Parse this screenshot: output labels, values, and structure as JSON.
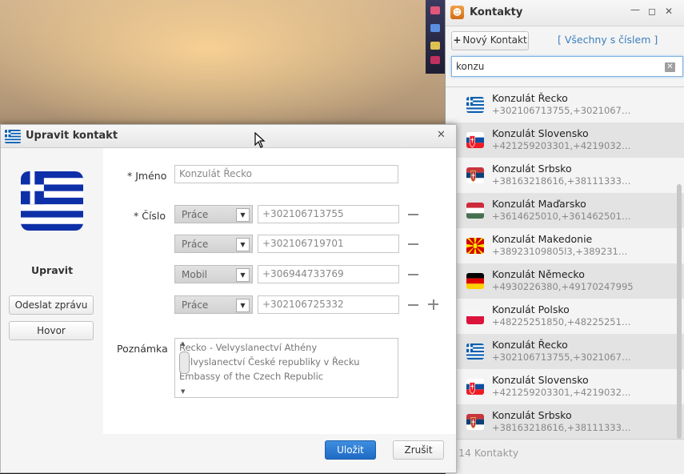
{
  "contacts_window": {
    "title": "Kontakty",
    "app_icon": "contacts-book-icon",
    "toolbar": {
      "new_contact_label": "Nový Kontakt",
      "filter_label": "[ Všechny s číslem ]"
    },
    "search": {
      "value": "konzu",
      "placeholder": ""
    },
    "items": [
      {
        "name": "Konzulát Řecko",
        "numbers": "+302106713755,+3021067…",
        "flag": "greece"
      },
      {
        "name": "Konzulát Slovensko",
        "numbers": "+421259203301,+4219032…",
        "flag": "slovakia"
      },
      {
        "name": "Konzulát Srbsko",
        "numbers": "+38163218616,+38111333…",
        "flag": "serbia"
      },
      {
        "name": "Konzulát Maďarsko",
        "numbers": "+3614625010,+361462501…",
        "flag": "hungary"
      },
      {
        "name": "Konzulát Makedonie",
        "numbers": "+38923109805l3,+389231…",
        "flag": "macedonia"
      },
      {
        "name": "Konzulát Německo",
        "numbers": "+4930226380,+49170247995",
        "flag": "germany"
      },
      {
        "name": "Konzulát Polsko",
        "numbers": "+48225251850,+48225251…",
        "flag": "poland"
      },
      {
        "name": "Konzulát Řecko",
        "numbers": "+302106713755,+3021067…",
        "flag": "greece"
      },
      {
        "name": "Konzulát Slovensko",
        "numbers": "+421259203301,+4219032…",
        "flag": "slovakia"
      },
      {
        "name": "Konzulát Srbsko",
        "numbers": "+38163218616,+38111333…",
        "flag": "serbia"
      }
    ],
    "footer": "14 Kontakty"
  },
  "edit_dialog": {
    "title": "Upravit kontakt",
    "avatar_caption": "Upravit",
    "send_message_label": "Odeslat zprávu",
    "call_label": "Hovor",
    "name_label": "* Jméno",
    "name_value": "Konzulát Řecko",
    "number_label": "* Číslo",
    "phones": [
      {
        "type": "Práce",
        "number": "+302106713755"
      },
      {
        "type": "Práce",
        "number": "+302106719701"
      },
      {
        "type": "Mobil",
        "number": "+306944733769"
      },
      {
        "type": "Práce",
        "number": "+302106725332"
      }
    ],
    "note_label": "Poznámka",
    "note_lines": [
      "Řecko - Velvyslanectví Athény",
      "Velvyslanectví České republiky v Řecku",
      "Embassy of the Czech Republic"
    ],
    "save_label": "Uložit",
    "cancel_label": "Zrušit"
  }
}
